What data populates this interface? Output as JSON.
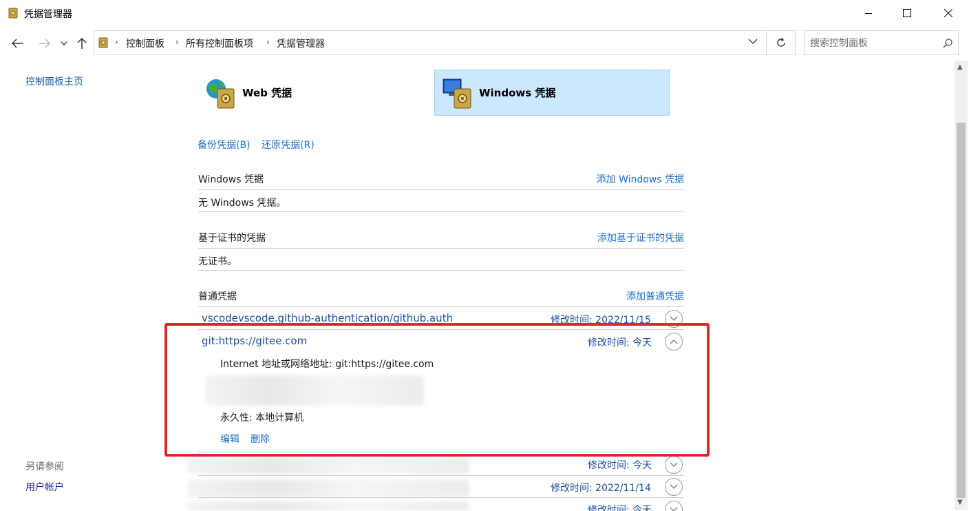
{
  "window": {
    "title": "凭据管理器"
  },
  "breadcrumb": [
    "控制面板",
    "所有控制面板项",
    "凭据管理器"
  ],
  "search": {
    "placeholder": "搜索控制面板"
  },
  "sidebar": {
    "home_link": "控制面板主页",
    "see_also_heading": "另请参阅",
    "user_accounts_link": "用户帐户"
  },
  "tabs": {
    "web": "Web 凭据",
    "windows": "Windows 凭据"
  },
  "actions": {
    "backup": "备份凭据(B)",
    "restore": "还原凭据(R)"
  },
  "sections": {
    "windows": {
      "title": "Windows 凭据",
      "add": "添加 Windows 凭据",
      "empty": "无 Windows 凭据。"
    },
    "cert": {
      "title": "基于证书的凭据",
      "add": "添加基于证书的凭据",
      "empty": "无证书。"
    },
    "generic": {
      "title": "普通凭据",
      "add": "添加普通凭据"
    }
  },
  "credentials": [
    {
      "name": "vscodevscode.github-authentication/github.auth",
      "modified": "修改时间: 2022/11/15",
      "expanded": false
    },
    {
      "name": "git:https://gitee.com",
      "modified": "修改时间: 今天",
      "expanded": true,
      "address": "Internet 地址或网络地址: git:https://gitee.com",
      "persistence": "永久性: 本地计算机",
      "edit": "编辑",
      "delete": "删除"
    },
    {
      "name": "",
      "modified": "修改时间: 今天",
      "expanded": false
    },
    {
      "name": "",
      "modified": "修改时间: 2022/11/14",
      "expanded": false
    },
    {
      "name": "",
      "modified": "修改时间: 今天",
      "expanded": false
    }
  ],
  "colors": {
    "link": "#1a6fc9",
    "selected_tab": "#cce8ff",
    "highlight_box": "#e3262a"
  }
}
